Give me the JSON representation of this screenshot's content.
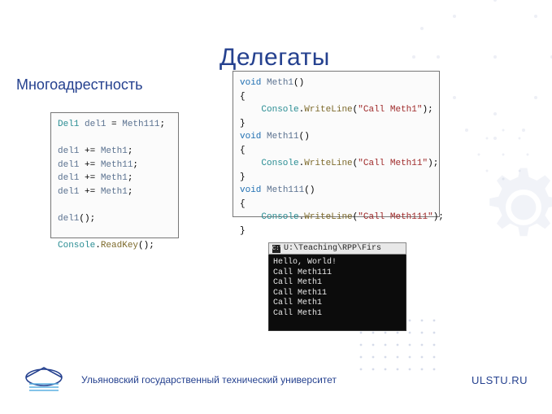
{
  "title": "Делегаты",
  "subtitle": "Многоадрестность",
  "code_left": {
    "lines": [
      [
        [
          "type",
          "Del1"
        ],
        [
          "plain",
          " "
        ],
        [
          "var",
          "del1"
        ],
        [
          "plain",
          " = "
        ],
        [
          "var",
          "Meth111"
        ],
        [
          "plain",
          ";"
        ]
      ],
      [
        [
          "plain",
          ""
        ]
      ],
      [
        [
          "var",
          "del1"
        ],
        [
          "plain",
          " += "
        ],
        [
          "var",
          "Meth1"
        ],
        [
          "plain",
          ";"
        ]
      ],
      [
        [
          "var",
          "del1"
        ],
        [
          "plain",
          " += "
        ],
        [
          "var",
          "Meth11"
        ],
        [
          "plain",
          ";"
        ]
      ],
      [
        [
          "var",
          "del1"
        ],
        [
          "plain",
          " += "
        ],
        [
          "var",
          "Meth1"
        ],
        [
          "plain",
          ";"
        ]
      ],
      [
        [
          "var",
          "del1"
        ],
        [
          "plain",
          " += "
        ],
        [
          "var",
          "Meth1"
        ],
        [
          "plain",
          ";"
        ]
      ],
      [
        [
          "plain",
          ""
        ]
      ],
      [
        [
          "var",
          "del1"
        ],
        [
          "plain",
          "();"
        ]
      ],
      [
        [
          "plain",
          ""
        ]
      ],
      [
        [
          "type",
          "Console"
        ],
        [
          "plain",
          "."
        ],
        [
          "mtd",
          "ReadKey"
        ],
        [
          "plain",
          "();"
        ]
      ]
    ]
  },
  "code_right": {
    "lines": [
      [
        [
          "kw",
          "void"
        ],
        [
          "plain",
          " "
        ],
        [
          "var",
          "Meth1"
        ],
        [
          "plain",
          "()"
        ]
      ],
      [
        [
          "plain",
          "{"
        ]
      ],
      [
        [
          "plain",
          "    "
        ],
        [
          "type",
          "Console"
        ],
        [
          "plain",
          "."
        ],
        [
          "mtd",
          "WriteLine"
        ],
        [
          "plain",
          "("
        ],
        [
          "str",
          "\"Call Meth1\""
        ],
        [
          "plain",
          ");"
        ]
      ],
      [
        [
          "plain",
          "}"
        ]
      ],
      [
        [
          "kw",
          "void"
        ],
        [
          "plain",
          " "
        ],
        [
          "var",
          "Meth11"
        ],
        [
          "plain",
          "()"
        ]
      ],
      [
        [
          "plain",
          "{"
        ]
      ],
      [
        [
          "plain",
          "    "
        ],
        [
          "type",
          "Console"
        ],
        [
          "plain",
          "."
        ],
        [
          "mtd",
          "WriteLine"
        ],
        [
          "plain",
          "("
        ],
        [
          "str",
          "\"Call Meth11\""
        ],
        [
          "plain",
          ");"
        ]
      ],
      [
        [
          "plain",
          "}"
        ]
      ],
      [
        [
          "kw",
          "void"
        ],
        [
          "plain",
          " "
        ],
        [
          "var",
          "Meth111"
        ],
        [
          "plain",
          "()"
        ]
      ],
      [
        [
          "plain",
          "{"
        ]
      ],
      [
        [
          "plain",
          "    "
        ],
        [
          "type",
          "Console"
        ],
        [
          "plain",
          "."
        ],
        [
          "mtd",
          "WriteLine"
        ],
        [
          "plain",
          "("
        ],
        [
          "str",
          "\"Call Meth111\""
        ],
        [
          "plain",
          ");"
        ]
      ],
      [
        [
          "plain",
          "}"
        ]
      ]
    ]
  },
  "console": {
    "title": "U:\\Teaching\\RPP\\Firs",
    "lines": [
      "Hello, World!",
      "Call Meth111",
      "Call Meth1",
      "Call Meth11",
      "Call Meth1",
      "Call Meth1"
    ]
  },
  "footer": {
    "university": "Ульяновский государственный технический университет",
    "url": "ULSTU.RU"
  }
}
